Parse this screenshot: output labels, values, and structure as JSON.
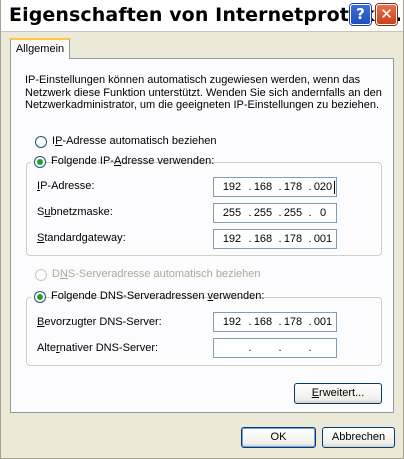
{
  "window": {
    "title": "Eigenschaften von Internetprotoko...",
    "help_glyph": "?",
    "close_glyph": "✕"
  },
  "tabs": [
    {
      "label": "Allgemein"
    }
  ],
  "description": "IP-Einstellungen können automatisch zugewiesen werden, wenn das Netzwerk diese Funktion unterstützt. Wenden Sie sich andernfalls an den Netzwerkadministrator, um die geeigneten IP-Einstellungen zu beziehen.",
  "ip_mode": {
    "auto": {
      "pre": "I",
      "key": "P",
      "post": "-Adresse automatisch beziehen",
      "selected": false
    },
    "manual": {
      "pre": "Folgende IP-",
      "key": "A",
      "post": "dresse verwenden:",
      "selected": true
    }
  },
  "ip_fields": {
    "ip_address": {
      "pre": "",
      "key": "I",
      "post": "P-Adresse:",
      "octets": [
        "192",
        "168",
        "178",
        "020"
      ]
    },
    "subnet": {
      "pre": "S",
      "key": "u",
      "post": "bnetzmaske:",
      "octets": [
        "255",
        "255",
        "255",
        "0"
      ]
    },
    "gateway": {
      "pre": "",
      "key": "S",
      "post": "tandardgateway:",
      "octets": [
        "192",
        "168",
        "178",
        "001"
      ]
    }
  },
  "dns_mode": {
    "auto": {
      "pre": "D",
      "key": "N",
      "post": "S-Serveradresse automatisch beziehen",
      "selected": false,
      "disabled": true
    },
    "manual": {
      "pre": "Folgende DNS-Serveradressen ",
      "key": "v",
      "post": "erwenden:",
      "selected": true
    }
  },
  "dns_fields": {
    "preferred": {
      "pre": "",
      "key": "B",
      "post": "evorzugter DNS-Server:",
      "octets": [
        "192",
        "168",
        "178",
        "001"
      ]
    },
    "alternate": {
      "pre": "Alte",
      "key": "r",
      "post": "nativer DNS-Server:",
      "octets": [
        "",
        "",
        "",
        ""
      ]
    }
  },
  "buttons": {
    "advanced": {
      "pre": "",
      "key": "E",
      "post": "rweitert..."
    },
    "ok": "OK",
    "cancel": "Abbrechen"
  },
  "colors": {
    "dialog_bg": "#ece9d8",
    "panel_bg": "#fcfcfe",
    "radio_dot": "#21a121",
    "field_border": "#7f9db9",
    "tab_highlight": "#ffc83c"
  }
}
